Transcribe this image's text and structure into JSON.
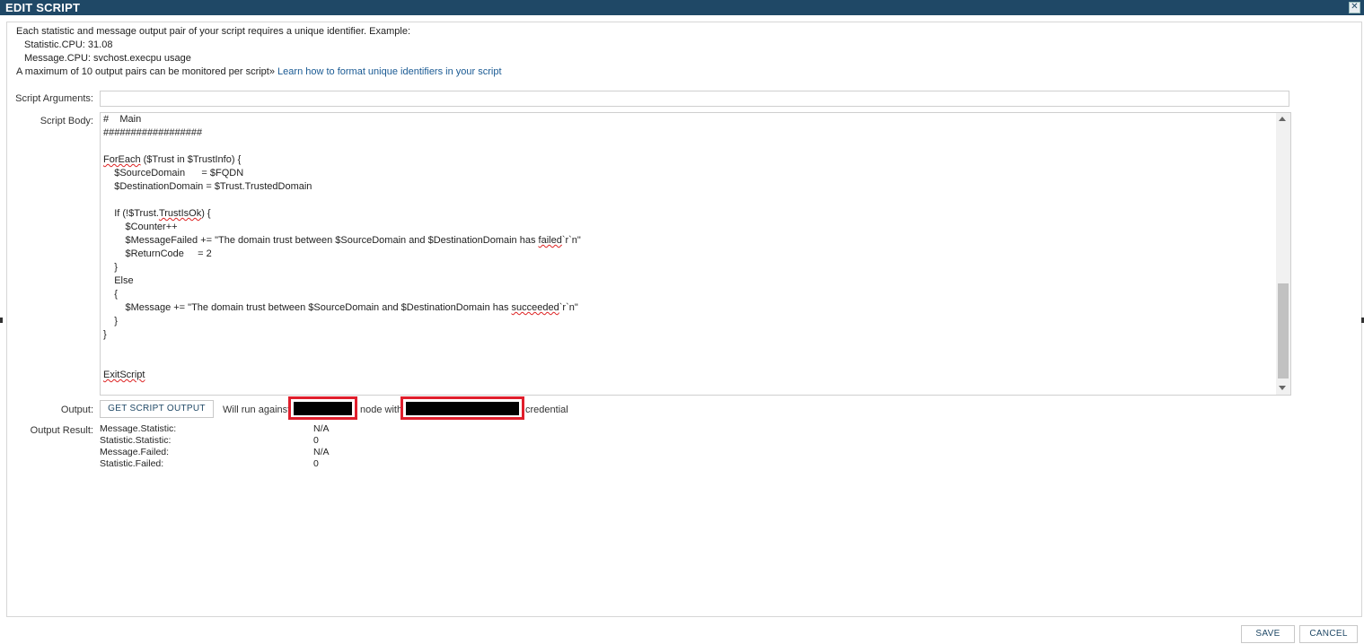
{
  "window": {
    "title": "EDIT SCRIPT",
    "close_icon": "close-icon"
  },
  "intro": {
    "line1": "Each statistic and message output pair of your script requires a unique identifier. Example:",
    "example_statistic": "Statistic.CPU: 31.08",
    "example_message": "Message.CPU: svchost.execpu usage",
    "max_text": "A maximum of 10 output pairs can be monitored per script»",
    "learn_link": "Learn how to format unique identifiers in your script"
  },
  "form": {
    "script_arguments_label": "Script Arguments:",
    "script_arguments_value": "",
    "script_body_label": "Script Body:",
    "output_label": "Output:",
    "output_result_label": "Output Result:"
  },
  "script_body": {
    "lines": [
      "#    Main",
      "##################",
      "",
      "ForEach ($Trust in $TrustInfo) {",
      "    $SourceDomain      = $FQDN",
      "    $DestinationDomain = $Trust.TrustedDomain",
      "",
      "    If (!$Trust.TrustIsOk) {",
      "        $Counter++",
      "        $MessageFailed += \"The domain trust between $SourceDomain and $DestinationDomain has failed`r`n\"",
      "        $ReturnCode     = 2",
      "    }",
      "    Else",
      "    {",
      "        $Message += \"The domain trust between $SourceDomain and $DestinationDomain has succeeded`r`n\"",
      "    }",
      "}",
      "",
      "",
      "ExitScript"
    ]
  },
  "output": {
    "get_button": "GET SCRIPT OUTPUT",
    "will_run_text": "Will run against",
    "node_with_text": "node with",
    "credential_text": "credential",
    "redaction_color": "#e01e2c"
  },
  "results": [
    {
      "key": "Message.Statistic:",
      "value": "N/A"
    },
    {
      "key": "Statistic.Statistic:",
      "value": "0"
    },
    {
      "key": "Message.Failed:",
      "value": "N/A"
    },
    {
      "key": "Statistic.Failed:",
      "value": "0"
    }
  ],
  "footer": {
    "save": "SAVE",
    "cancel": "CANCEL"
  },
  "colors": {
    "titlebar": "#1f4866",
    "link": "#1a5a93"
  }
}
